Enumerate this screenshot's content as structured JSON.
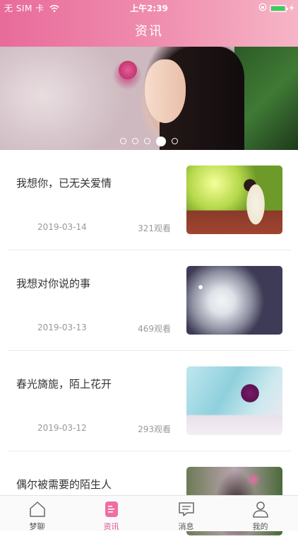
{
  "status_bar": {
    "carrier": "无 SIM 卡",
    "time": "上午2:39"
  },
  "header": {
    "title": "资讯"
  },
  "banner": {
    "slides": 5,
    "active_index": 3
  },
  "articles": [
    {
      "title": "我想你，已无关爱情",
      "date": "2019-03-14",
      "views": "321观看"
    },
    {
      "title": "我想对你说的事",
      "date": "2019-03-13",
      "views": "469观看"
    },
    {
      "title": "春光旖旎，陌上花开",
      "date": "2019-03-12",
      "views": "293观看"
    },
    {
      "title": "偶尔被需要的陌生人",
      "date": "",
      "views": ""
    }
  ],
  "tabs": [
    {
      "label": "梦聊",
      "icon": "home-icon"
    },
    {
      "label": "资讯",
      "icon": "document-icon"
    },
    {
      "label": "消息",
      "icon": "message-icon"
    },
    {
      "label": "我的",
      "icon": "user-icon"
    }
  ],
  "colors": {
    "accent": "#e0508a",
    "header_start": "#e86b9a",
    "header_end": "#f6b5c6"
  }
}
